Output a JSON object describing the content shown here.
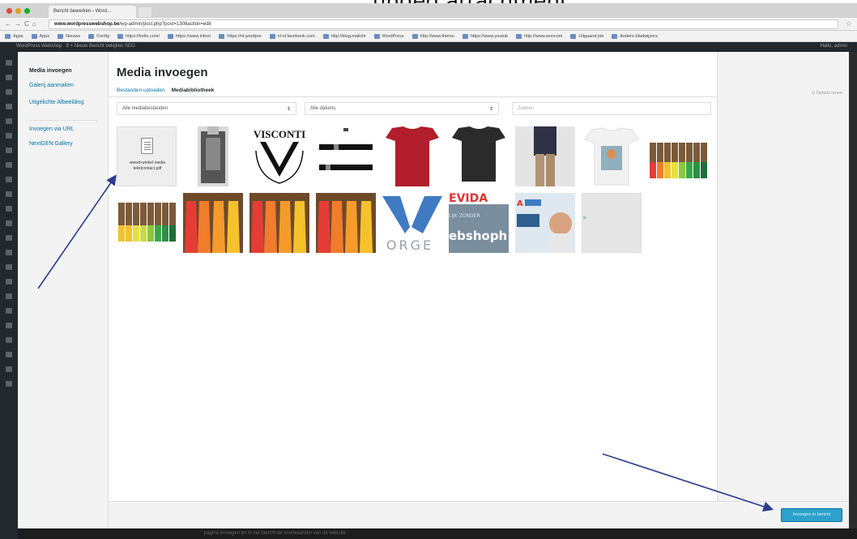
{
  "caption": "unded attachment",
  "browser": {
    "tab_title": "Bericht bewerken ‹ Word…",
    "url_domain": "www.wordpresswebshop.be",
    "url_path": "/wp-admin/post.php?post=1308action=edit",
    "bookmarks": [
      "Apps",
      "Apps",
      "Nieuws",
      "Config",
      "https://trello.com/",
      "https://www.infonr",
      "https://nl.wordpre",
      "nl-nl.facebook.com",
      "http://blog.mailchi",
      "WordPress",
      "http://www.themo",
      "https://www.youtub",
      "http://www.woocom",
      "Uitgaand job",
      "Andere bladwijzers"
    ]
  },
  "admin_bar": {
    "site": "WordPress Webshop",
    "items": "8  +  Nieuw   Bericht bekijken   SEO",
    "greeting": "Hallo, admin"
  },
  "modal": {
    "side_menu": {
      "items": [
        "Media invoegen",
        "Galerij aanmaken",
        "Uitgelichte Afbeelding"
      ],
      "items2": [
        "Invoegen via URL",
        "NextGEN Gallery"
      ]
    },
    "title": "Media invoegen",
    "tabs": [
      "Bestanden uploaden",
      "Mediabibliotheek"
    ],
    "filter_type": "Alle mediabestanden",
    "filter_date": "Alle datums",
    "search_placeholder": "Zoeken",
    "details_link": "Details tonen",
    "doc_name": "wwwd-winkel media tekstcontact.pdf",
    "insert_button": "Invoegen in bericht",
    "background_text": "pagina invoegen en in het bericht de voorwaarden van de website"
  }
}
